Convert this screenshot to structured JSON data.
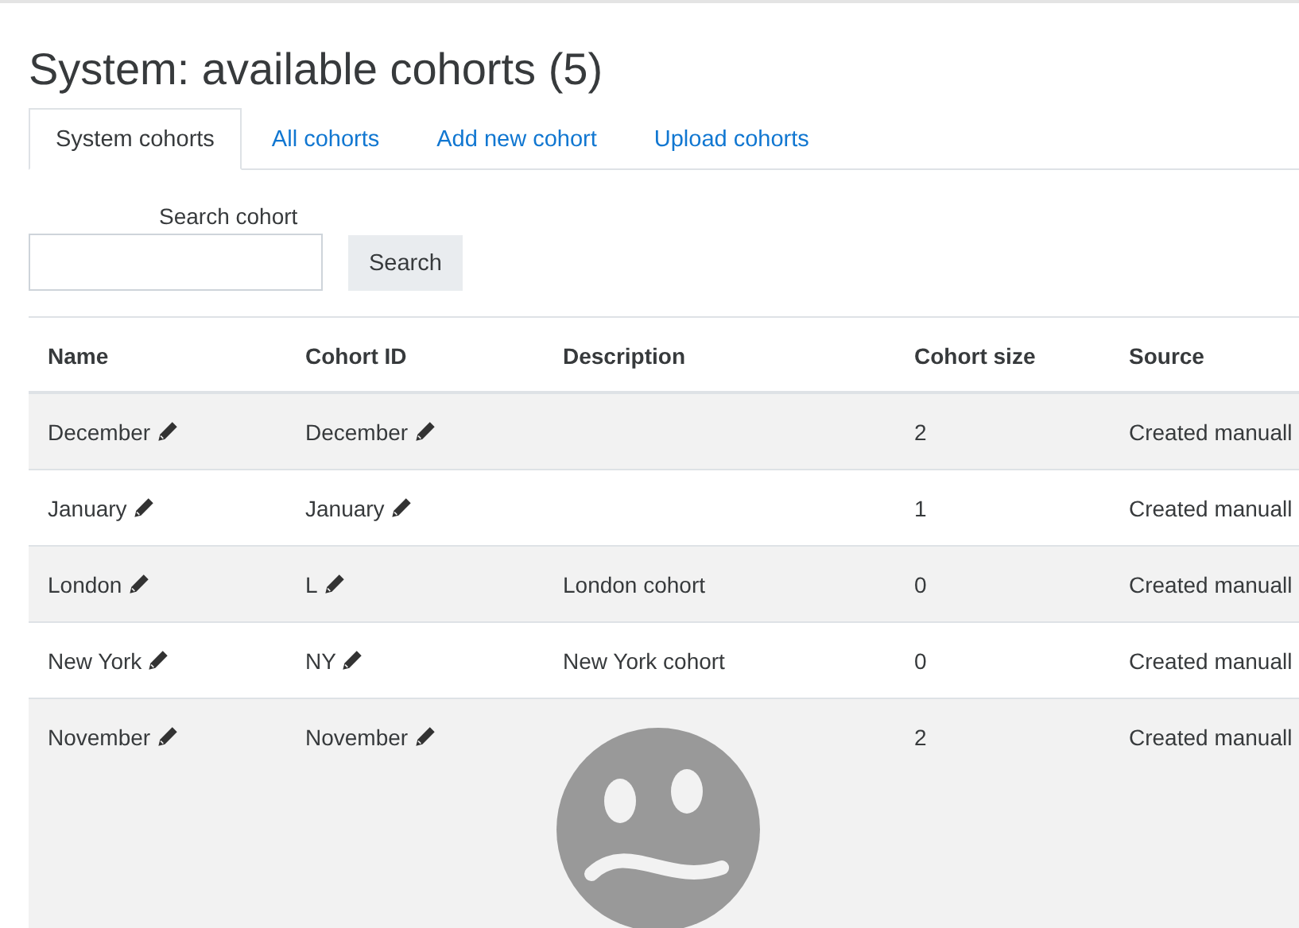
{
  "title": "System: available cohorts (5)",
  "tabs": [
    {
      "label": "System cohorts",
      "selected": true
    },
    {
      "label": "All cohorts",
      "selected": false
    },
    {
      "label": "Add new cohort",
      "selected": false
    },
    {
      "label": "Upload cohorts",
      "selected": false
    }
  ],
  "search": {
    "label": "Search cohort",
    "button": "Search"
  },
  "table": {
    "columns": [
      "Name",
      "Cohort ID",
      "Description",
      "Cohort size",
      "Source"
    ],
    "rows": [
      {
        "name": "December",
        "cohort_id": "December",
        "description": "",
        "size": "2",
        "source": "Created manuall",
        "has_image": false
      },
      {
        "name": "January",
        "cohort_id": "January",
        "description": "",
        "size": "1",
        "source": "Created manuall",
        "has_image": false
      },
      {
        "name": "London",
        "cohort_id": "L",
        "description": "London cohort",
        "size": "0",
        "source": "Created manuall",
        "has_image": false
      },
      {
        "name": "New York",
        "cohort_id": "NY",
        "description": "New York cohort",
        "size": "0",
        "source": "Created manuall",
        "has_image": false
      },
      {
        "name": "November",
        "cohort_id": "November",
        "description": "",
        "size": "2",
        "source": "Created manuall",
        "has_image": true
      }
    ]
  }
}
